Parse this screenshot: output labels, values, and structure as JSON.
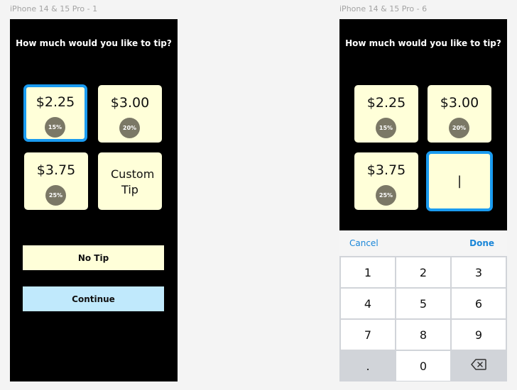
{
  "frames": {
    "left_label": "iPhone 14 & 15 Pro - 1",
    "right_label": "iPhone 14 & 15 Pro - 6"
  },
  "tip_screen": {
    "title": "How much would you like to tip?",
    "options": [
      {
        "amount": "$2.25",
        "percent": "15%"
      },
      {
        "amount": "$3.00",
        "percent": "20%"
      },
      {
        "amount": "$3.75",
        "percent": "25%"
      }
    ],
    "custom_label": "Custom Tip",
    "custom_input_value": "|",
    "no_tip_label": "No Tip",
    "continue_label": "Continue"
  },
  "keyboard": {
    "cancel_label": "Cancel",
    "done_label": "Done",
    "keys": [
      "1",
      "2",
      "3",
      "4",
      "5",
      "6",
      "7",
      "8",
      "9",
      ".",
      "0"
    ],
    "delete_icon": "backspace-icon"
  },
  "colors": {
    "tile": "#ffffd9",
    "selected_border": "#1a9bf0",
    "continue": "#c0e9fc",
    "badge": "#7b7866",
    "link": "#1a86d8"
  }
}
